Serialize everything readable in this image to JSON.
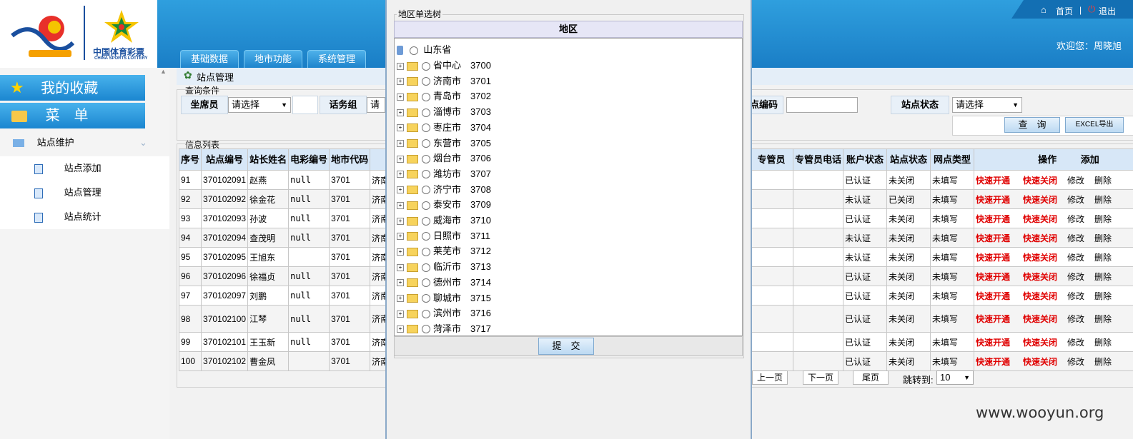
{
  "header": {
    "home_label": "首页",
    "logout_label": "退出",
    "separator": "|",
    "welcome": "欢迎您：周晓旭",
    "brand_cn": "中国体育彩票",
    "brand_en": "CHINA SPORTS LOTTERY",
    "nav": [
      "基础数据",
      "地市功能",
      "系统管理"
    ]
  },
  "sidebar": {
    "favorites_label": "我的收藏",
    "menu_label": "菜　单",
    "group_label": "站点维护",
    "items": [
      "站点添加",
      "站点管理",
      "站点统计"
    ]
  },
  "main": {
    "page_title": "站点管理",
    "query_legend": "查询条件",
    "filters": {
      "agent_label": "坐席员",
      "agent_value": "请选择",
      "group_label": "话务组",
      "group_value": "请选择",
      "code_label": "点编码",
      "status_label": "站点状态",
      "status_value": "请选择"
    },
    "query_button": "查　询",
    "excel_button": "EXCEL导出",
    "list_legend": "信息列表",
    "columns_left": [
      "序号",
      "站点编号",
      "站长姓名",
      "电彩编号",
      "地市代码"
    ],
    "columns_right": [
      "专管员",
      "专管员电话",
      "账户状态",
      "站点状态",
      "网点类型",
      "操作",
      "添加"
    ],
    "rows": [
      {
        "seq": "91",
        "code": "370102091",
        "name": "赵燕",
        "ec": "null",
        "city": "3701",
        "region": "济南",
        "acct": "已认证",
        "status": "未关闭",
        "type": "未填写"
      },
      {
        "seq": "92",
        "code": "370102092",
        "name": "徐金花",
        "ec": "null",
        "city": "3701",
        "region": "济南",
        "acct": "未认证",
        "status": "已关闭",
        "type": "未填写"
      },
      {
        "seq": "93",
        "code": "370102093",
        "name": "孙波",
        "ec": "null",
        "city": "3701",
        "region": "济南",
        "acct": "已认证",
        "status": "未关闭",
        "type": "未填写"
      },
      {
        "seq": "94",
        "code": "370102094",
        "name": "查茂明",
        "ec": "null",
        "city": "3701",
        "region": "济南",
        "acct": "未认证",
        "status": "未关闭",
        "type": "未填写"
      },
      {
        "seq": "95",
        "code": "370102095",
        "name": "王旭东",
        "ec": "",
        "city": "3701",
        "region": "济南",
        "acct": "未认证",
        "status": "未关闭",
        "type": "未填写"
      },
      {
        "seq": "96",
        "code": "370102096",
        "name": "徐福贞",
        "ec": "null",
        "city": "3701",
        "region": "济南",
        "acct": "已认证",
        "status": "未关闭",
        "type": "未填写"
      },
      {
        "seq": "97",
        "code": "370102097",
        "name": "刘鹏",
        "ec": "null",
        "city": "3701",
        "region": "济南",
        "acct": "已认证",
        "status": "未关闭",
        "type": "未填写"
      },
      {
        "seq": "98",
        "code": "370102100",
        "name": "江琴",
        "ec": "null",
        "city": "3701",
        "region": "济南",
        "acct": "已认证",
        "status": "未关闭",
        "type": "未填写"
      },
      {
        "seq": "99",
        "code": "370102101",
        "name": "王玉新",
        "ec": "null",
        "city": "3701",
        "region": "济南",
        "acct": "已认证",
        "status": "未关闭",
        "type": "未填写"
      },
      {
        "seq": "100",
        "code": "370102102",
        "name": "曹金凤",
        "ec": "",
        "city": "3701",
        "region": "济南",
        "acct": "已认证",
        "status": "未关闭",
        "type": "未填写"
      }
    ],
    "row_actions": {
      "open": "快速开通",
      "close": "快速关闭",
      "edit": "修改",
      "delete": "删除"
    },
    "pager": {
      "prev": "上一页",
      "next": "下一页",
      "last": "尾页",
      "jump_label": "跳转到:",
      "jump_value": "10"
    }
  },
  "modal": {
    "title": "地区单选树",
    "column_header": "地区",
    "root": "山东省",
    "nodes": [
      "省中心　3700",
      "济南市　3701",
      "青岛市　3702",
      "淄博市　3703",
      "枣庄市　3704",
      "东营市　3705",
      "烟台市　3706",
      "潍坊市　3707",
      "济宁市　3708",
      "泰安市　3709",
      "威海市　3710",
      "日照市　3711",
      "莱芜市　3712",
      "临沂市　3713",
      "德州市　3714",
      "聊城市　3715",
      "滨州市　3716",
      "菏泽市　3717"
    ],
    "submit_label": "提　交"
  },
  "watermark": "www.wooyun.org",
  "colors": {
    "header_blue": "#1a7ec6",
    "action_red": "#e00000",
    "table_header": "#d7e7f7"
  }
}
